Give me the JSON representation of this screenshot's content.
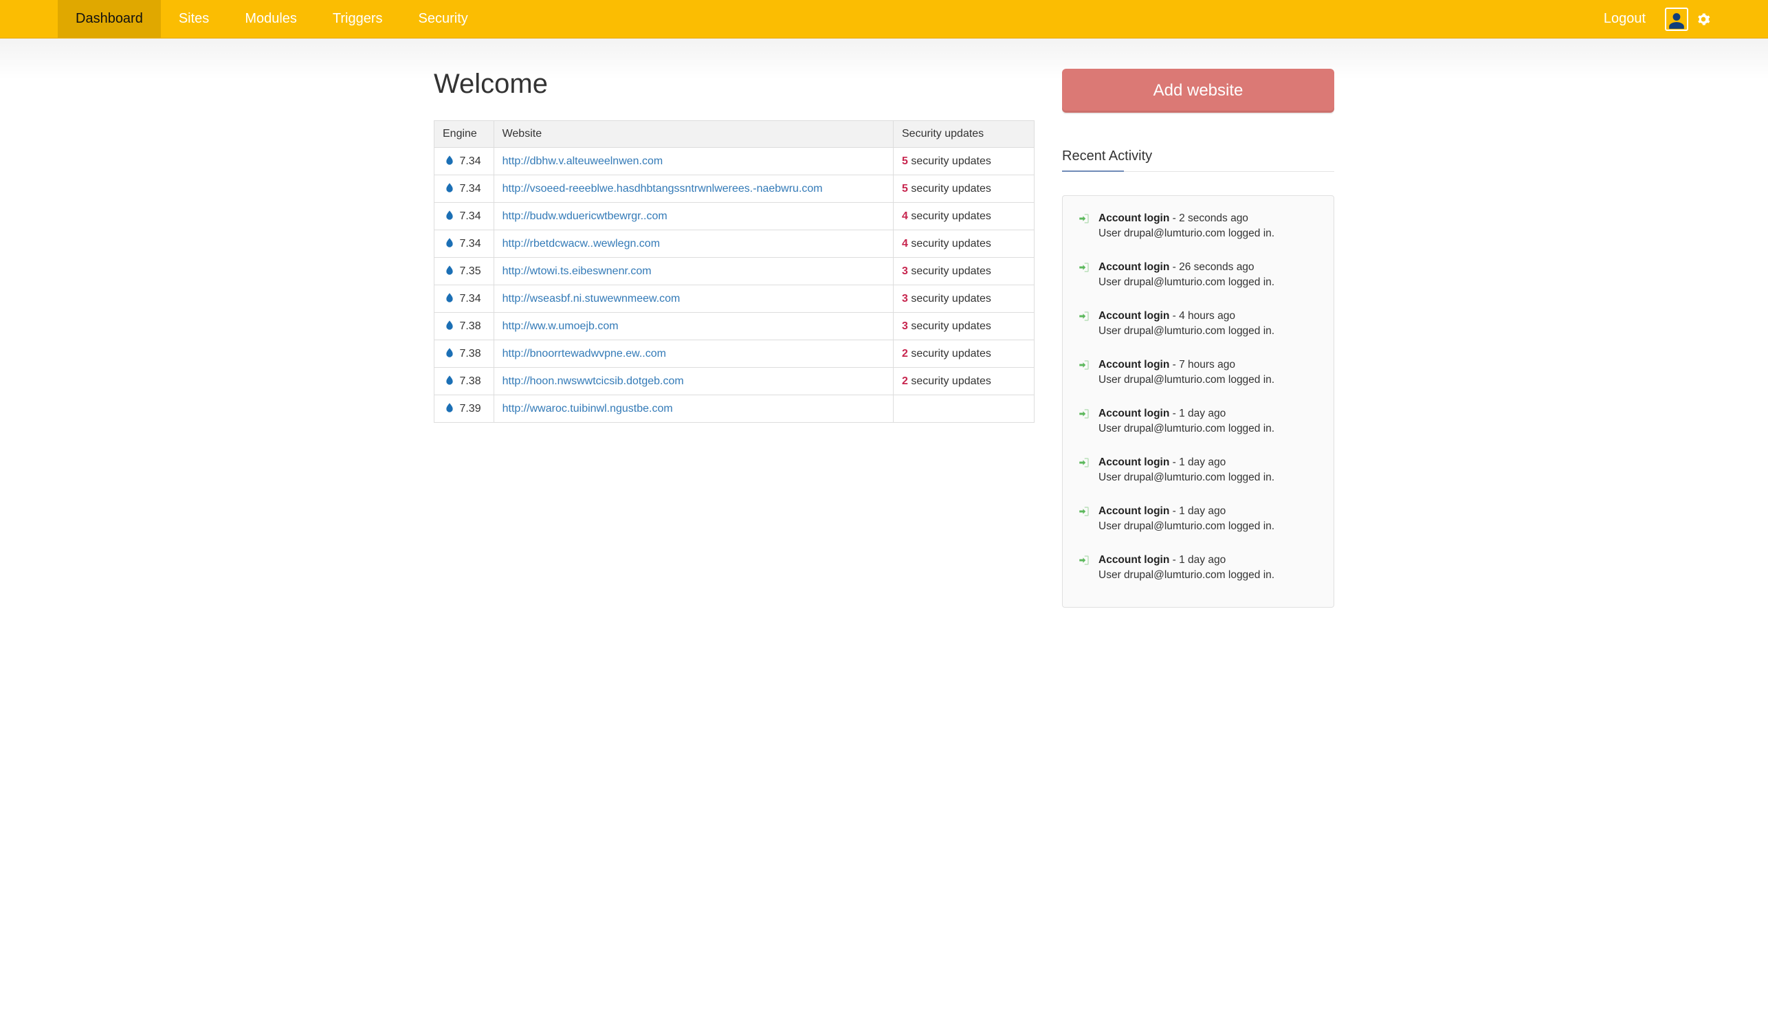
{
  "nav": {
    "items": [
      {
        "label": "Dashboard",
        "active": true
      },
      {
        "label": "Sites",
        "active": false
      },
      {
        "label": "Modules",
        "active": false
      },
      {
        "label": "Triggers",
        "active": false
      },
      {
        "label": "Security",
        "active": false
      }
    ],
    "logout_label": "Logout"
  },
  "page": {
    "title": "Welcome"
  },
  "sites_table": {
    "headers": {
      "engine": "Engine",
      "website": "Website",
      "security": "Security updates"
    },
    "rows": [
      {
        "engine": "7.34",
        "url": "http://dbhw.v.alteuweelnwen.com",
        "updates": 5
      },
      {
        "engine": "7.34",
        "url": "http://vsoeed-reeeblwe.hasdhbtangssntrwnlwerees.-naebwru.com",
        "updates": 5
      },
      {
        "engine": "7.34",
        "url": "http://budw.wduericwtbewrgr..com",
        "updates": 4
      },
      {
        "engine": "7.34",
        "url": "http://rbetdcwacw..wewlegn.com",
        "updates": 4
      },
      {
        "engine": "7.35",
        "url": "http://wtowi.ts.eibeswnenr.com",
        "updates": 3
      },
      {
        "engine": "7.34",
        "url": "http://wseasbf.ni.stuwewnmeew.com",
        "updates": 3
      },
      {
        "engine": "7.38",
        "url": "http://ww.w.umoejb.com",
        "updates": 3
      },
      {
        "engine": "7.38",
        "url": "http://bnoorrtewadwvpne.ew..com",
        "updates": 2
      },
      {
        "engine": "7.38",
        "url": "http://hoon.nwswwtcicsib.dotgeb.com",
        "updates": 2
      },
      {
        "engine": "7.39",
        "url": "http://wwaroc.tuibinwl.ngustbe.com",
        "updates": null
      }
    ],
    "updates_suffix": "security updates"
  },
  "sidebar": {
    "add_button": "Add website",
    "recent_activity_title": "Recent Activity",
    "activity": [
      {
        "title": "Account login",
        "time": "2 seconds ago",
        "detail": "User drupal@lumturio.com logged in."
      },
      {
        "title": "Account login",
        "time": "26 seconds ago",
        "detail": "User drupal@lumturio.com logged in."
      },
      {
        "title": "Account login",
        "time": "4 hours ago",
        "detail": "User drupal@lumturio.com logged in."
      },
      {
        "title": "Account login",
        "time": "7 hours ago",
        "detail": "User drupal@lumturio.com logged in."
      },
      {
        "title": "Account login",
        "time": "1 day ago",
        "detail": "User drupal@lumturio.com logged in."
      },
      {
        "title": "Account login",
        "time": "1 day ago",
        "detail": "User drupal@lumturio.com logged in."
      },
      {
        "title": "Account login",
        "time": "1 day ago",
        "detail": "User drupal@lumturio.com logged in."
      },
      {
        "title": "Account login",
        "time": "1 day ago",
        "detail": "User drupal@lumturio.com logged in."
      }
    ]
  }
}
